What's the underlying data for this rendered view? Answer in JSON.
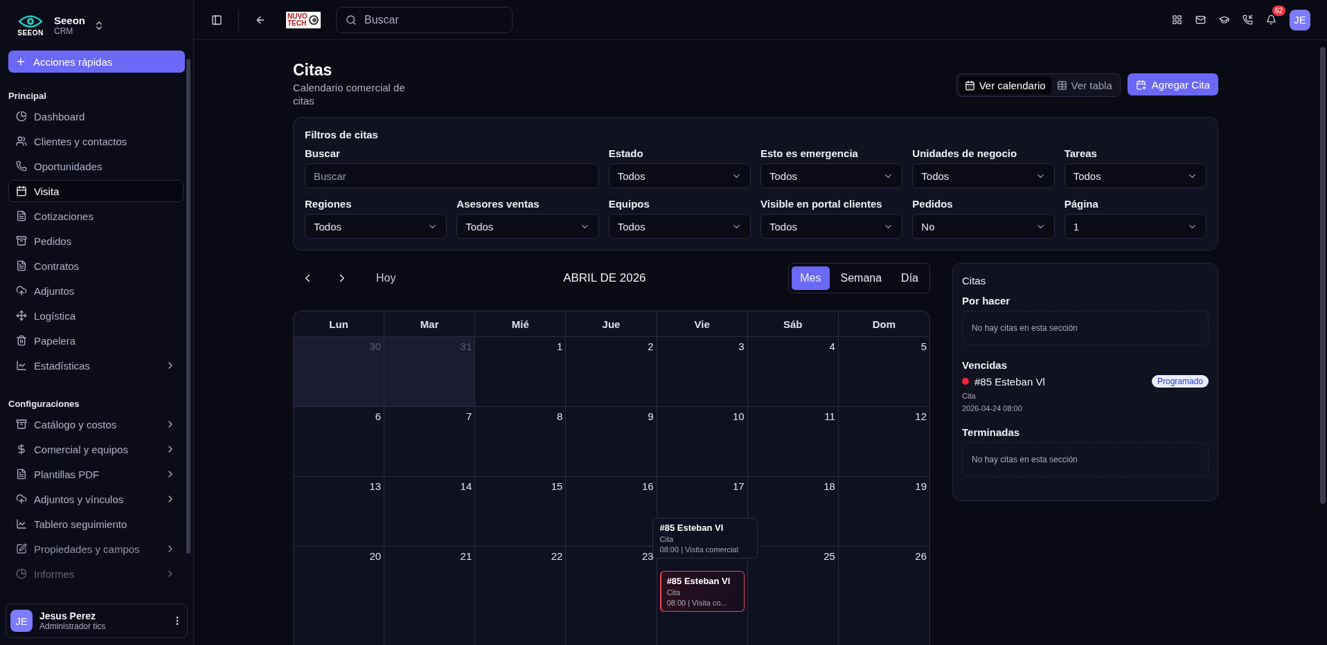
{
  "sidebar": {
    "brand": {
      "logo_text": "SEEON",
      "name": "Seeon",
      "subtitle": "CRM"
    },
    "quick_action": "Acciones rápidas",
    "sections": [
      {
        "title": "Principal",
        "items": [
          {
            "label": "Dashboard",
            "selected": false,
            "has_submenu": false
          },
          {
            "label": "Clientes y contactos",
            "selected": false,
            "has_submenu": false
          },
          {
            "label": "Oportunidades",
            "selected": false,
            "has_submenu": false
          },
          {
            "label": "Visita",
            "selected": true,
            "has_submenu": false
          },
          {
            "label": "Cotizaciones",
            "selected": false,
            "has_submenu": false
          },
          {
            "label": "Pedidos",
            "selected": false,
            "has_submenu": false
          },
          {
            "label": "Contratos",
            "selected": false,
            "has_submenu": false
          },
          {
            "label": "Adjuntos",
            "selected": false,
            "has_submenu": false
          },
          {
            "label": "Logística",
            "selected": false,
            "has_submenu": false
          },
          {
            "label": "Papelera",
            "selected": false,
            "has_submenu": false
          },
          {
            "label": "Estadísticas",
            "selected": false,
            "has_submenu": true
          }
        ]
      },
      {
        "title": "Configuraciones",
        "items": [
          {
            "label": "Catálogo y costos",
            "selected": false,
            "has_submenu": true
          },
          {
            "label": "Comercial y equipos",
            "selected": false,
            "has_submenu": true
          },
          {
            "label": "Plantillas PDF",
            "selected": false,
            "has_submenu": true
          },
          {
            "label": "Adjuntos y vínculos",
            "selected": false,
            "has_submenu": true
          },
          {
            "label": "Tablero seguimiento",
            "selected": false,
            "has_submenu": false
          },
          {
            "label": "Propiedades y campos",
            "selected": false,
            "has_submenu": true
          },
          {
            "label": "Informes",
            "selected": false,
            "has_submenu": true
          }
        ]
      }
    ],
    "user": {
      "initials": "JE",
      "name": "Jesus Perez",
      "role": "Administrador tics"
    }
  },
  "topbar": {
    "company_logo": [
      "NUVO",
      "TECH"
    ],
    "search": {
      "placeholder": "Buscar"
    },
    "notification_count": "62",
    "user_initials": "JE"
  },
  "page": {
    "title": "Citas",
    "subtitle": "Calendario comercial de citas",
    "view_toggle": [
      {
        "label": "Ver calendario",
        "selected": true
      },
      {
        "label": "Ver tabla",
        "selected": false
      }
    ],
    "add_button": "Agregar Cita"
  },
  "filters": {
    "title": "Filtros de citas",
    "fields": [
      {
        "kind": "text",
        "label": "Buscar",
        "placeholder": "Buscar"
      },
      {
        "kind": "select",
        "label": "Estado",
        "value": "Todos"
      },
      {
        "kind": "select",
        "label": "Esto es emergencia",
        "value": "Todos"
      },
      {
        "kind": "select",
        "label": "Unidades de negocio",
        "value": "Todos"
      },
      {
        "kind": "select",
        "label": "Tareas",
        "value": "Todos"
      },
      {
        "kind": "select",
        "label": "Regiones",
        "value": "Todos"
      },
      {
        "kind": "select",
        "label": "Asesores ventas",
        "value": "Todos"
      },
      {
        "kind": "select",
        "label": "Equipos",
        "value": "Todos"
      },
      {
        "kind": "select",
        "label": "Visible en portal clientes",
        "value": "Todos"
      },
      {
        "kind": "select",
        "label": "Pedidos",
        "value": "No"
      },
      {
        "kind": "select",
        "label": "Página",
        "value": "1"
      }
    ]
  },
  "calendar": {
    "today_button": "Hoy",
    "month_label": "ABRIL DE 2026",
    "views": [
      {
        "label": "Mes",
        "selected": true
      },
      {
        "label": "Semana",
        "selected": false
      },
      {
        "label": "Día",
        "selected": false
      }
    ],
    "weekdays": [
      "Lun",
      "Mar",
      "Mié",
      "Jue",
      "Vie",
      "Sáb",
      "Dom"
    ],
    "weeks": [
      [
        {
          "day": "30",
          "outside": true
        },
        {
          "day": "31",
          "outside": true
        },
        {
          "day": "1",
          "outside": false
        },
        {
          "day": "2",
          "outside": false
        },
        {
          "day": "3",
          "outside": false
        },
        {
          "day": "4",
          "outside": false
        },
        {
          "day": "5",
          "outside": false
        }
      ],
      [
        {
          "day": "6",
          "outside": false
        },
        {
          "day": "7",
          "outside": false
        },
        {
          "day": "8",
          "outside": false
        },
        {
          "day": "9",
          "outside": false
        },
        {
          "day": "10",
          "outside": false
        },
        {
          "day": "11",
          "outside": false
        },
        {
          "day": "12",
          "outside": false
        }
      ],
      [
        {
          "day": "13",
          "outside": false
        },
        {
          "day": "14",
          "outside": false
        },
        {
          "day": "15",
          "outside": false
        },
        {
          "day": "16",
          "outside": false
        },
        {
          "day": "17",
          "outside": false
        },
        {
          "day": "18",
          "outside": false
        },
        {
          "day": "19",
          "outside": false
        }
      ],
      [
        {
          "day": "20",
          "outside": false
        },
        {
          "day": "21",
          "outside": false
        },
        {
          "day": "22",
          "outside": false
        },
        {
          "day": "23",
          "outside": false
        },
        {
          "outside": false,
          "events": [
            {
              "title": "#85 Esteban Vl",
              "type": "Cita",
              "detail": "08:00 | Visita co...",
              "color": "#e0475a",
              "tooltip": {
                "title": "#85 Esteban Vl",
                "type": "Cita",
                "detail": "08:00 | Visita comercial"
              }
            }
          ]
        },
        {
          "day": "25",
          "outside": false
        },
        {
          "day": "26",
          "outside": false
        }
      ]
    ]
  },
  "agenda": {
    "title": "Citas",
    "sections": [
      {
        "title": "Por hacer",
        "empty_text": "No hay citas en esta sección"
      },
      {
        "title": "Vencidas",
        "items": [
          {
            "title": "#85 Esteban Vl",
            "color": "#f0243a",
            "status": "Programado",
            "type": "Cita",
            "datetime": "2026-04-24 08:00"
          }
        ]
      },
      {
        "title": "Terminadas",
        "empty_text": "No hay citas en esta sección"
      }
    ]
  }
}
